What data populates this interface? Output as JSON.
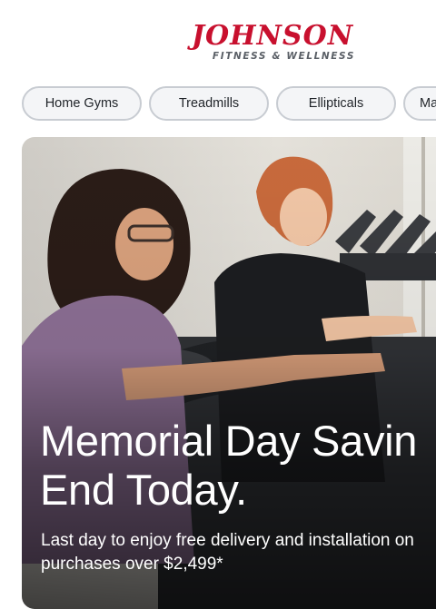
{
  "brand": {
    "name": "JOHNSON",
    "tagline": "FITNESS & WELLNESS"
  },
  "categories": [
    {
      "label": "Home Gyms"
    },
    {
      "label": "Treadmills"
    },
    {
      "label": "Ellipticals"
    },
    {
      "label": "Ma"
    }
  ],
  "hero": {
    "headline_line1": "Memorial Day Savin",
    "headline_line2": "End Today.",
    "subtext": "Last day to enjoy free delivery and installation on purchases over $2,499*"
  },
  "colors": {
    "brand_red": "#c8102e",
    "tagline_gray": "#5a5f66",
    "chip_border": "#c8ccd2",
    "chip_bg": "#f4f5f7"
  }
}
